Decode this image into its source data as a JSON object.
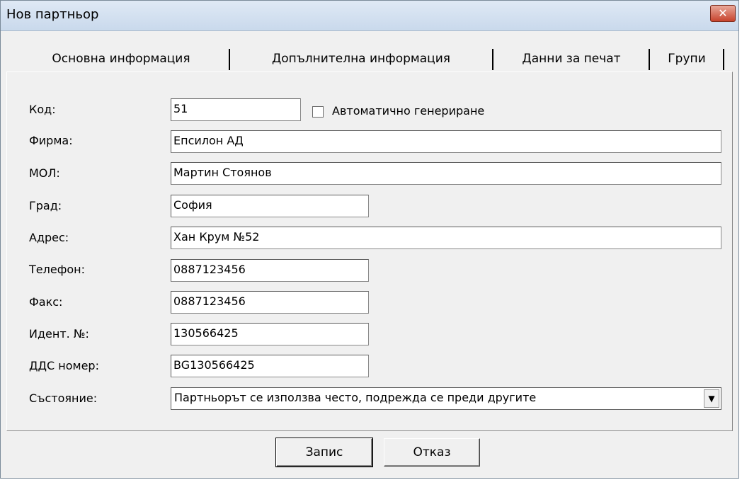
{
  "window": {
    "title": "Нов партньор",
    "close_glyph": "✕"
  },
  "tabs": [
    {
      "label": "Основна информация"
    },
    {
      "label": "Допълнителна информация"
    },
    {
      "label": "Данни за печат"
    },
    {
      "label": "Групи"
    }
  ],
  "form": {
    "code": {
      "label": "Код:",
      "value": "51"
    },
    "auto_generate": {
      "label": "Автоматично генериране",
      "checked": false
    },
    "company": {
      "label": "Фирма:",
      "value": "Епсилон АД"
    },
    "mol": {
      "label": "МОЛ:",
      "value": "Мартин Стоянов"
    },
    "city": {
      "label": "Град:",
      "value": "София"
    },
    "address": {
      "label": "Адрес:",
      "value": "Хан Крум №52"
    },
    "phone": {
      "label": "Телефон:",
      "value": "0887123456"
    },
    "fax": {
      "label": "Факс:",
      "value": "0887123456"
    },
    "ident": {
      "label": "Идент. №:",
      "value": "130566425"
    },
    "vat": {
      "label": "ДДС номер:",
      "value": "BG130566425"
    },
    "status": {
      "label": "Състояние:",
      "value": "Партньорът се използва често, подрежда се преди другите"
    }
  },
  "buttons": {
    "save": "Запис",
    "cancel": "Отказ"
  },
  "icons": {
    "close": "close-icon",
    "dropdown": "chevron-down-icon"
  },
  "colors": {
    "close_button": "#c7432c",
    "titlebar": "#c9d9ec",
    "window_bg": "#f0f0f0"
  }
}
